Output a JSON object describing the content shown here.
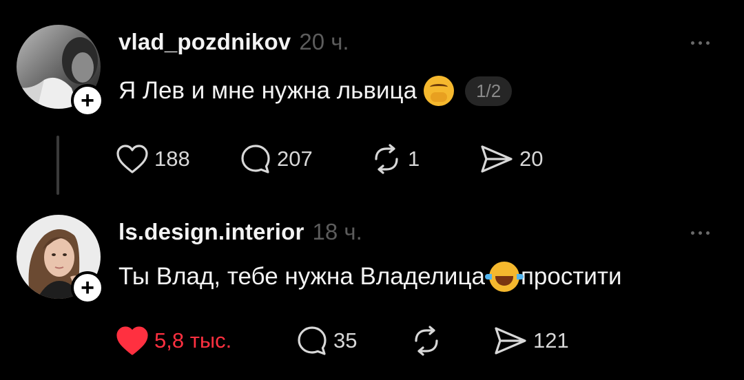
{
  "posts": [
    {
      "username": "vlad_pozdnikov",
      "time": "20 ч.",
      "text": "Я Лев и мне нужна львица",
      "emoji": "hand-over-mouth-emoji",
      "page_indicator": "1/2",
      "likes": "188",
      "comments": "207",
      "reposts": "1",
      "shares": "20",
      "liked": false
    },
    {
      "username": "ls.design.interior",
      "time": "18 ч.",
      "text_before": "Ты Влад, тебе нужна Владелица",
      "emoji": "tears-of-joy-emoji",
      "text_after": "простити",
      "likes": "5,8 тыс.",
      "comments": "35",
      "shares": "121",
      "liked": true
    }
  ],
  "colors": {
    "background": "#000000",
    "text": "#f3f3f3",
    "muted": "#5c5c5c",
    "like_active": "#ff3040"
  },
  "icons": [
    "heart-icon",
    "comment-icon",
    "repost-icon",
    "share-icon",
    "more-icon",
    "plus-icon"
  ]
}
